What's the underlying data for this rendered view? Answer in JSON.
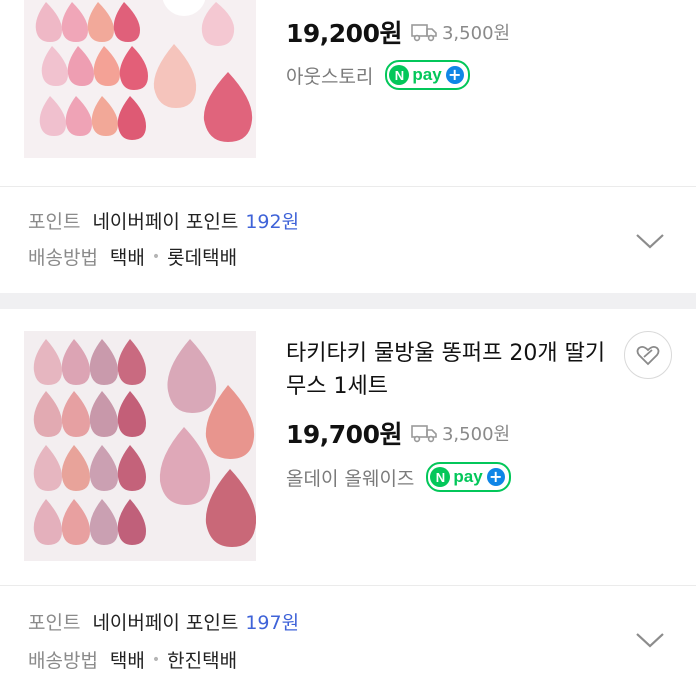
{
  "product1": {
    "price": "19,200원",
    "shipping_fee": "3,500원",
    "store": "아웃스토리",
    "npay_label": "pay",
    "npay_n": "N",
    "points_label": "포인트",
    "points_source": "네이버페이 포인트",
    "points_value": "192원",
    "delivery_label": "배송방법",
    "delivery_type": "택배",
    "courier": "롯데택배"
  },
  "product2": {
    "title": "타키타키 물방울 똥퍼프 20개 딸기무스 1세트",
    "price": "19,700원",
    "shipping_fee": "3,500원",
    "store": "올데이 올웨이즈",
    "npay_label": "pay",
    "npay_n": "N",
    "points_label": "포인트",
    "points_source": "네이버페이 포인트",
    "points_value": "197원",
    "delivery_label": "배송방법",
    "delivery_type": "택배",
    "courier": "한진택배"
  },
  "colors": {
    "npay_green": "#03c75a",
    "points_blue": "#3f63d8",
    "plus_blue": "#0f86e6"
  },
  "icons": [
    "truck-icon",
    "chevron-down-icon",
    "heart-tag-icon",
    "npay-badge"
  ]
}
